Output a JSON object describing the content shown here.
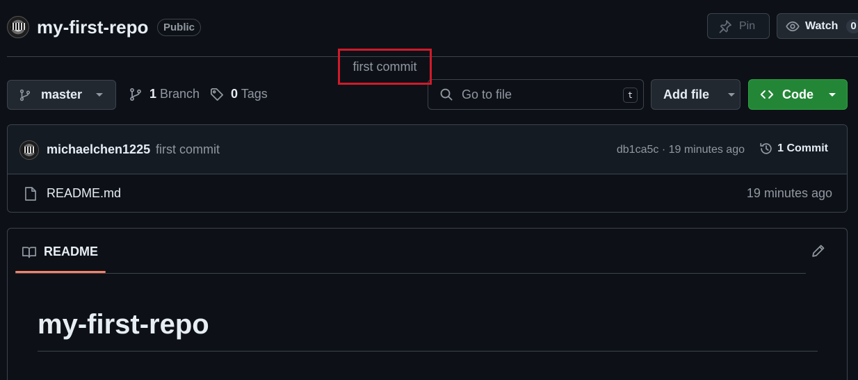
{
  "header": {
    "repo_name": "my-first-repo",
    "visibility": "Public",
    "pin_label": "Pin",
    "watch_label": "Watch",
    "watch_count": "0"
  },
  "toolbar": {
    "branch": "master",
    "branch_count": "1",
    "branch_label": "Branch",
    "tag_count": "0",
    "tag_label": "Tags",
    "search_placeholder": "Go to file",
    "search_shortcut": "t",
    "add_file_label": "Add file",
    "code_label": "Code"
  },
  "latest_commit": {
    "author": "michaelchen1225",
    "message": "first commit",
    "sha_time": "db1ca5c · 19 minutes ago",
    "commits_label": "1 Commit"
  },
  "files": [
    {
      "name": "README.md",
      "commit_message": "first commit",
      "time": "19 minutes ago"
    }
  ],
  "readme": {
    "tab_label": "README",
    "heading": "my-first-repo"
  },
  "colors": {
    "background": "#0d1117",
    "accent_green": "#238636",
    "tab_underline": "#f78166",
    "highlight_box": "#d11a2a"
  }
}
